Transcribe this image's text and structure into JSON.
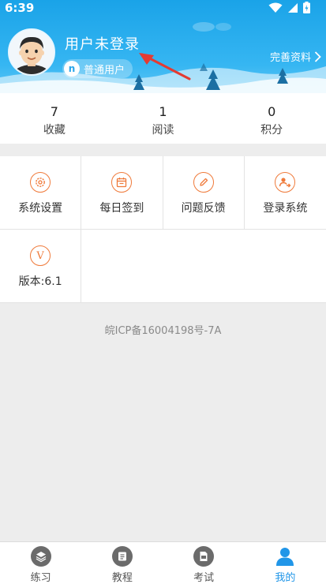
{
  "status_bar": {
    "time": "6:39"
  },
  "profile": {
    "title": "用户未登录",
    "badge_icon_text": "n",
    "badge_label": "普通用户",
    "complete_profile_label": "完善资料"
  },
  "stats": [
    {
      "value": "7",
      "label": "收藏"
    },
    {
      "value": "1",
      "label": "阅读"
    },
    {
      "value": "0",
      "label": "积分"
    }
  ],
  "menu": {
    "row1": [
      {
        "icon": "gear-icon",
        "label": "系统设置"
      },
      {
        "icon": "calendar-icon",
        "label": "每日签到"
      },
      {
        "icon": "pencil-icon",
        "label": "问题反馈"
      },
      {
        "icon": "login-icon",
        "label": "登录系统"
      }
    ],
    "row2": [
      {
        "icon": "version-icon",
        "label": "版本:6.1",
        "icon_text": "V"
      }
    ]
  },
  "footer": {
    "icp": "皖ICP备16004198号-7A"
  },
  "bottom_nav": [
    {
      "icon": "layers-icon",
      "label": "练习"
    },
    {
      "icon": "book-icon",
      "label": "教程"
    },
    {
      "icon": "exam-icon",
      "label": "考试"
    },
    {
      "icon": "user-icon",
      "label": "我的",
      "active": true
    }
  ],
  "colors": {
    "header_blue": "#1aa3e8",
    "accent_orange": "#ef7a3a",
    "active_blue": "#2196e8"
  }
}
